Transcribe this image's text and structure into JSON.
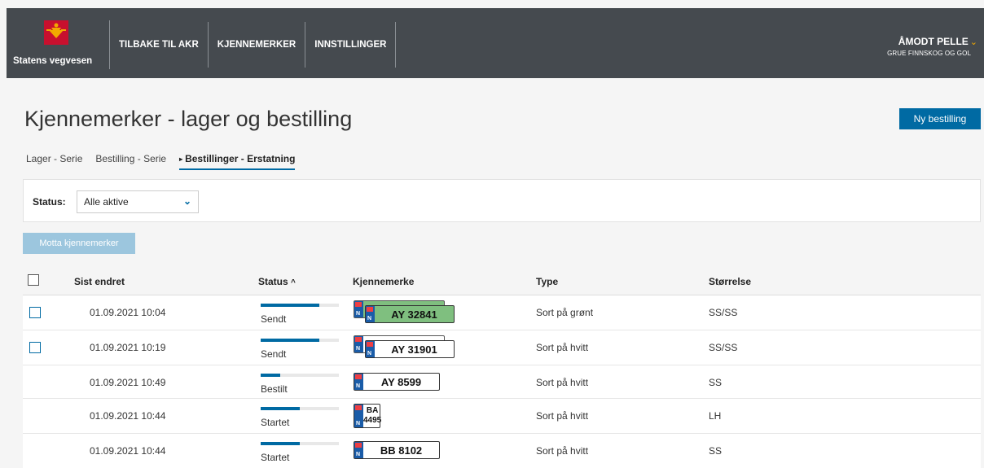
{
  "header": {
    "logo_text": "Statens vegvesen",
    "nav": [
      "TILBAKE TIL AKR",
      "KJENNEMERKER",
      "INNSTILLINGER"
    ],
    "user_name": "ÅMODT PELLE",
    "user_org": "GRUE FINNSKOG OG GOL"
  },
  "page": {
    "title": "Kjennemerker - lager og bestilling",
    "new_order_button": "Ny bestilling",
    "tabs": [
      "Lager - Serie",
      "Bestilling - Serie",
      "Bestillinger - Erstatning"
    ],
    "active_tab": 2
  },
  "filter": {
    "status_label": "Status:",
    "status_value": "Alle aktive"
  },
  "receive_button": "Motta kjennemerker",
  "table": {
    "headers": {
      "changed": "Sist endret",
      "status": "Status",
      "status_sort": "^",
      "plate": "Kjennemerke",
      "type": "Type",
      "size": "Størrelse"
    },
    "rows": [
      {
        "checkbox": true,
        "changed": "01.09.2021 10:04",
        "status": "Sendt",
        "progress": 0.75,
        "plate": "AY 32841",
        "plate_color": "green",
        "double": true,
        "type": "Sort på grønt",
        "size": "SS/SS"
      },
      {
        "checkbox": true,
        "changed": "01.09.2021 10:19",
        "status": "Sendt",
        "progress": 0.75,
        "plate": "AY 31901",
        "plate_color": "white",
        "double": true,
        "type": "Sort på hvitt",
        "size": "SS/SS"
      },
      {
        "checkbox": false,
        "changed": "01.09.2021 10:49",
        "status": "Bestilt",
        "progress": 0.25,
        "plate": "AY 8599",
        "plate_color": "white",
        "double": false,
        "type": "Sort på hvitt",
        "size": "SS"
      },
      {
        "checkbox": false,
        "changed": "01.09.2021 10:44",
        "status": "Startet",
        "progress": 0.5,
        "plate_line1": "BA",
        "plate_line2": "4495",
        "plate_color": "white",
        "double": false,
        "type": "Sort på hvitt",
        "size": "LH"
      },
      {
        "checkbox": false,
        "changed": "01.09.2021 10:44",
        "status": "Startet",
        "progress": 0.5,
        "plate": "BB 8102",
        "plate_color": "white",
        "double": false,
        "type": "Sort på hvitt",
        "size": "SS"
      }
    ]
  },
  "colors": {
    "header_bg": "#454a4f",
    "accent": "#006aa3",
    "plate_green": "#7fbf7f"
  }
}
